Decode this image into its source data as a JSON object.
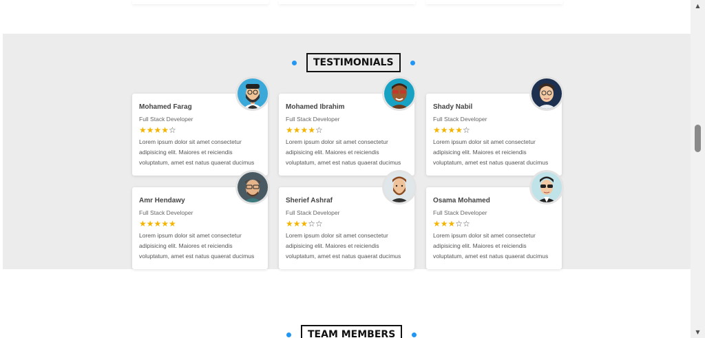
{
  "testimonials": {
    "title": "TESTIMONIALS",
    "items": [
      {
        "name": "Mohamed Farag",
        "role": "Full Stack Developer",
        "rating": 4,
        "stars": "★★★★",
        "empty": "☆",
        "text": "Lorem ipsum dolor sit amet consectetur adipisicing elit. Maiores et reiciendis voluptatum, amet est natus quaerat ducimus",
        "avatar": "avatar-bearded-cap-glasses"
      },
      {
        "name": "Mohamed Ibrahim",
        "role": "Full Stack Developer",
        "rating": 4,
        "stars": "★★★★",
        "empty": "☆",
        "text": "Lorem ipsum dolor sit amet consectetur adipisicing elit. Maiores et reiciendis voluptatum, amet est natus quaerat ducimus",
        "avatar": "avatar-sunglasses"
      },
      {
        "name": "Shady Nabil",
        "role": "Full Stack Developer",
        "rating": 4,
        "stars": "★★★★",
        "empty": "☆",
        "text": "Lorem ipsum dolor sit amet consectetur adipisicing elit. Maiores et reiciendis voluptatum, amet est natus quaerat ducimus",
        "avatar": "avatar-glasses-dark-hair"
      },
      {
        "name": "Amr Hendawy",
        "role": "Full Stack Developer",
        "rating": 5,
        "stars": "★★★★★",
        "empty": "",
        "text": "Lorem ipsum dolor sit amet consectetur adipisicing elit. Maiores et reiciendis voluptatum, amet est natus quaerat ducimus",
        "avatar": "avatar-glasses-beanie"
      },
      {
        "name": "Sherief Ashraf",
        "role": "Full Stack Developer",
        "rating": 3,
        "stars": "★★★",
        "empty": "☆☆",
        "text": "Lorem ipsum dolor sit amet consectetur adipisicing elit. Maiores et reiciendis voluptatum, amet est natus quaerat ducimus",
        "avatar": "avatar-beard"
      },
      {
        "name": "Osama Mohamed",
        "role": "Full Stack Developer",
        "rating": 3,
        "stars": "★★★",
        "empty": "☆☆",
        "text": "Lorem ipsum dolor sit amet consectetur adipisicing elit. Maiores et reiciendis voluptatum, amet est natus quaerat ducimus",
        "avatar": "avatar-shades"
      }
    ]
  },
  "team": {
    "title": "TEAM MEMBERS"
  },
  "colors": {
    "accent": "#2196f3",
    "star": "#f4b400",
    "section_bg": "#ececec"
  }
}
